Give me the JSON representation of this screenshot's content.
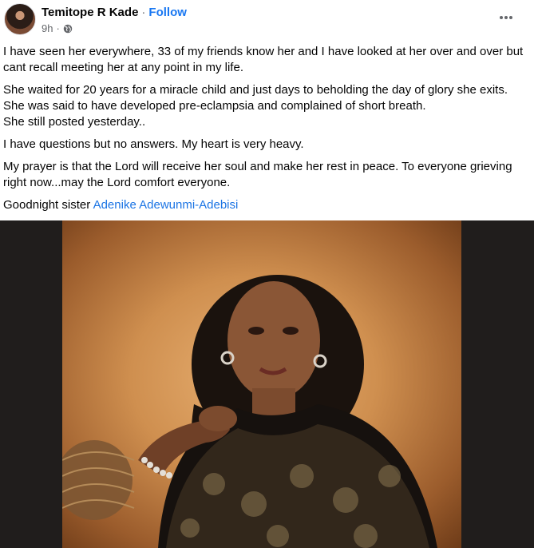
{
  "post": {
    "author": "Temitope R Kade",
    "separator": "·",
    "follow_label": "Follow",
    "time": "9h",
    "privacy_icon": "globe-icon",
    "more_icon": "more-horizontal-icon",
    "paragraphs": [
      "I have seen her everywhere, 33 of my friends know her and I have looked at her over and over but cant recall meeting her at any point in my life.",
      "She waited for 20 years for a miracle child and  just days to beholding the day of glory she exits.",
      "She was said to have developed pre-eclampsia and complained of short breath.",
      "She still posted yesterday..",
      "I have questions but no answers. My heart is very heavy.",
      "My prayer is that the Lord will receive her soul and make her rest in peace. To everyone grieving right now...may the Lord comfort everyone.",
      "Goodnight sister "
    ],
    "mention": "Adenike Adewunmi-Adebisi"
  },
  "colors": {
    "link": "#1877f2",
    "muted": "#65676b",
    "photo_background": "#201d1c"
  }
}
